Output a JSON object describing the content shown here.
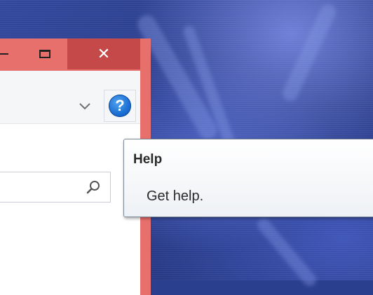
{
  "window": {
    "close_glyph": "✕",
    "help_glyph": "?",
    "dropdown_glyph": "⌄"
  },
  "tooltip": {
    "title": "Help",
    "body": "Get help."
  },
  "icons": {
    "restore": "restore-icon",
    "maximize": "maximize-icon",
    "close": "close-icon",
    "dropdown": "chevron-down-icon",
    "help": "help-icon",
    "search": "search-icon"
  },
  "colors": {
    "titlebar": "#e8706c",
    "close_button": "#c6494a",
    "help_icon": "#1b6ed2",
    "desktop": "#2b3f8f"
  }
}
